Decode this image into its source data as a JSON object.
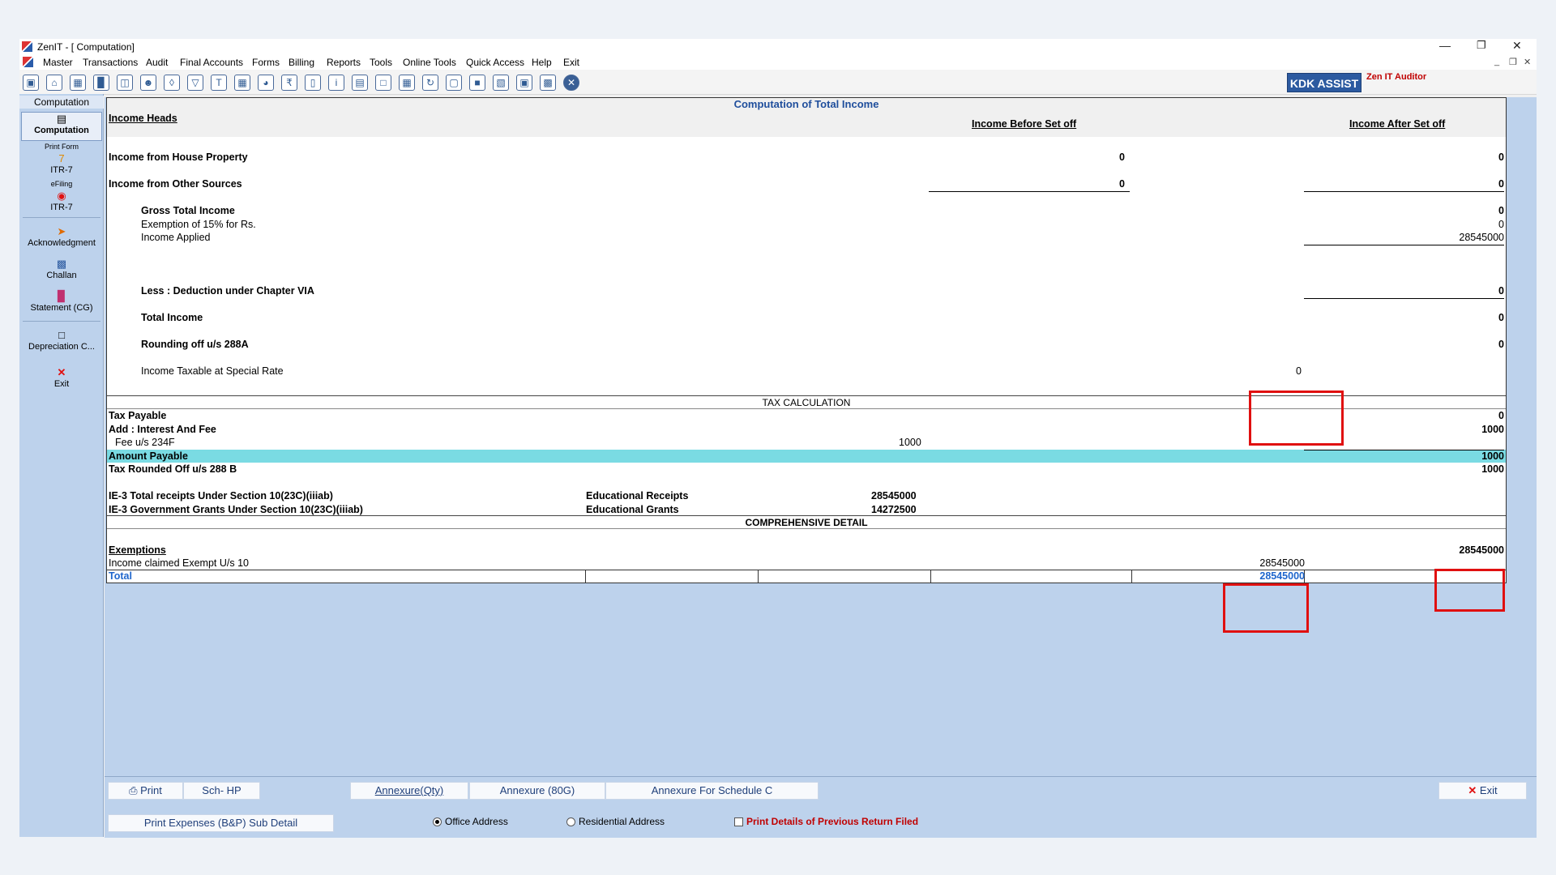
{
  "window": {
    "title": "ZenIT - [ Computation]"
  },
  "menu": [
    "Master",
    "Transactions",
    "Audit",
    "Final Accounts",
    "Forms",
    "Billing",
    "Reports",
    "Tools",
    "Online Tools",
    "Quick Access",
    "Help",
    "Exit"
  ],
  "toolbar": {
    "kdk_assist": "KDK ASSIST",
    "zen_label": "Zen IT Auditor"
  },
  "sidebar": {
    "header": "Computation",
    "items": [
      {
        "label": "Computation"
      },
      {
        "caption": "Print Form"
      },
      {
        "label": "ITR-7"
      },
      {
        "caption": "eFiling"
      },
      {
        "label": "ITR-7"
      },
      {
        "label": "Acknowledgment"
      },
      {
        "label": "Challan"
      },
      {
        "label": "Statement (CG)"
      },
      {
        "label": "Depreciation C..."
      },
      {
        "label": "Exit"
      }
    ]
  },
  "sheet": {
    "title": "Computation of Total Income",
    "col_heads": "Income Heads",
    "col_before": "Income Before Set off",
    "col_after": "Income After Set off",
    "house_property": {
      "label": "Income from House Property",
      "before": "0",
      "after": "0"
    },
    "other_sources": {
      "label": "Income from Other Sources",
      "before": "0",
      "after": "0"
    },
    "gross_total": {
      "label": "Gross Total Income",
      "value": "0"
    },
    "exemption": {
      "label": "Exemption of 15% for Rs.",
      "value": "0"
    },
    "income_applied": {
      "label": "Income Applied",
      "value": "28545000"
    },
    "deduction": {
      "label": "Less : Deduction under Chapter VIA",
      "value": "0"
    },
    "total_income": {
      "label": "Total Income",
      "value": "0"
    },
    "rounding": {
      "label": "Rounding off u/s 288A",
      "value": "0"
    },
    "special_rate": {
      "label": "Income Taxable at Special Rate",
      "value": "0"
    },
    "tax_calc_band": "TAX CALCULATION",
    "tax_payable": {
      "label": "Tax Payable",
      "value": "0"
    },
    "interest_fee": {
      "label": "Add : Interest And Fee",
      "value": "1000"
    },
    "fee_234f": {
      "label": "Fee u/s 234F",
      "value": "1000"
    },
    "amount_payable": {
      "label": "Amount Payable",
      "value": "1000"
    },
    "tax_rounded": {
      "label": "Tax Rounded Off u/s 288 B",
      "value": "1000"
    },
    "ie3_receipts": {
      "label": "IE-3 Total receipts Under Section 10(23C)(iiiab)",
      "mid": "Educational Receipts",
      "value": "28545000"
    },
    "ie3_grants": {
      "label": "IE-3 Government Grants Under Section 10(23C)(iiiab)",
      "mid": "Educational Grants",
      "value": "14272500"
    },
    "comprehensive_band": "COMPREHENSIVE DETAIL",
    "exemptions": {
      "label": "Exemptions",
      "value": "28545000"
    },
    "exempt_u10": {
      "label": "Income claimed Exempt U/s 10",
      "value": "28545000"
    },
    "total": {
      "label": "Total",
      "value": "28545000"
    }
  },
  "bottom": {
    "print": "Print",
    "sch_hp": "Sch- HP",
    "annexure_qty": "Annexure(Qty)",
    "annexure_80g": "Annexure (80G)",
    "annexure_c": "Annexure For Schedule C",
    "exit": "Exit",
    "print_expenses": "Print Expenses (B&P) Sub Detail",
    "office_address": "Office Address",
    "residential_address": "Residential Address",
    "print_prev": "Print Details of Previous Return Filed"
  },
  "colors": {
    "accent": "#1f4e9c",
    "highlight_row": "#7adbe3",
    "annotation_red": "#e01010",
    "panel_bg": "#bdd2ec"
  }
}
